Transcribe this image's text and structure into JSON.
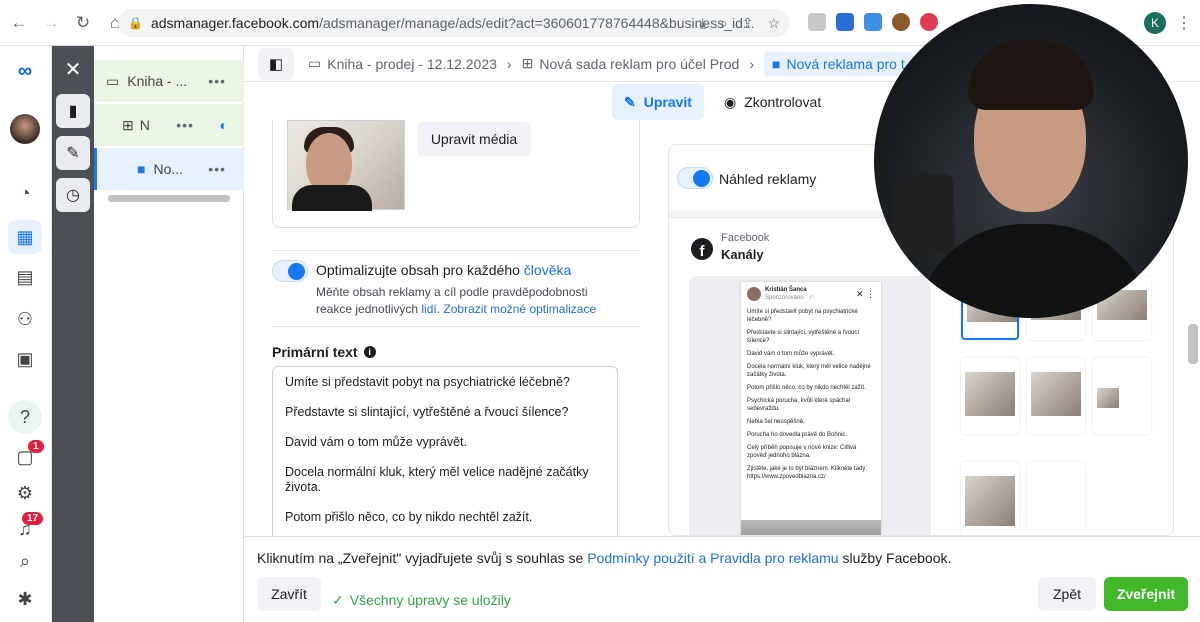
{
  "browser": {
    "url_host": "adsmanager.facebook.com",
    "url_path": "/adsmanager/manage/ads/edit?act=360601778764448&business_id...",
    "profile_initial": "K"
  },
  "nav": {
    "notifications_badge": "1",
    "alerts_badge": "17"
  },
  "tree": {
    "campaign": "Kniha - ...",
    "adset": "N",
    "ad": "No..."
  },
  "breadcrumbs": {
    "campaign": "Kniha - prodej - 12.12.2023",
    "adset": "Nová sada reklam pro účel Prod",
    "ad": "Nová reklama pro t"
  },
  "modes": {
    "edit": "Upravit",
    "review": "Zkontrolovat"
  },
  "editor": {
    "edit_media_button": "Upravit média",
    "optimize_title": "Optimalizujte obsah pro každého ",
    "optimize_title_link": "člověka",
    "optimize_desc": "Měňte obsah reklamy a cíl podle pravděpodobnosti reakce jednotlivých ",
    "optimize_desc_link1": "lidí",
    "optimize_desc_link2": "Zobrazit možné optimalizace",
    "primary_text_label": "Primární text",
    "primary_text_lines": [
      "Umíte si představit pobyt na psychiatrické léčebně?",
      "Představte si slintající, vytřeštěné a řvoucí šílence?",
      "David vám o tom může vyprávět.",
      "Docela normální kluk, který měl velice nadějné začátky života.",
      "Potom přišlo něco, co by nikdo nechtěl zažít."
    ]
  },
  "preview": {
    "toggle_label": "Náhled reklamy",
    "channel_sub": "Facebook",
    "channel_title": "Kanály",
    "post_author": "Kristián Šanca",
    "post_meta": "Sponzorováno · ⚐",
    "post_lines": [
      "Umíte si představit pobyt na psychiatrické léčebně?",
      "Představte si slintající, vytřeštěné a řvoucí šílence?",
      "David vám o tom může vyprávět.",
      "Docela normální kluk, který měl velice nadějné začátky života.",
      "Potom přišlo něco, co by nikdo nechtěl zažít.",
      "Psychická porucha, kvůli které spáchal sebevraždu.",
      "Nebla šel neúspěšně.",
      "Porucha ho dovedla právě do Bohnic.",
      "Celý příběh popisuje v nové knize: Citlivá zpověď jednoho blázna.",
      "Zjistěte, jaké je to být bláznem. Klikněte tady: https://www.zpovedblazna.cz/"
    ]
  },
  "footer": {
    "terms_prefix": "Kliknutím na „Zveřejnit\" vyjadřujete svůj s souhlas se ",
    "terms_link": "Podmínky použití a Pravidla pro reklamu",
    "terms_suffix": " služby Facebook.",
    "close_button": "Zavřít",
    "saved_status": "Všechny úpravy se uložily",
    "back_button": "Zpět",
    "publish_button": "Zveřejnit"
  },
  "colors": {
    "accent": "#1877f2",
    "publish": "#42b72a",
    "saved": "#31a24c"
  }
}
